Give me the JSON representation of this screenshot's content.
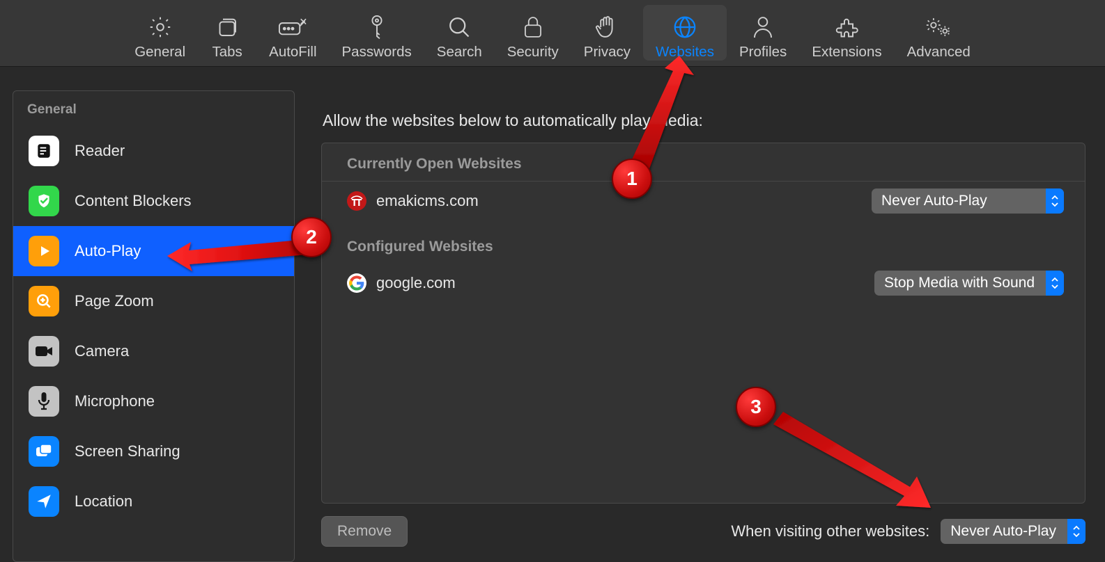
{
  "toolbar": {
    "items": [
      {
        "id": "general",
        "label": "General"
      },
      {
        "id": "tabs",
        "label": "Tabs"
      },
      {
        "id": "autofill",
        "label": "AutoFill"
      },
      {
        "id": "passwords",
        "label": "Passwords"
      },
      {
        "id": "search",
        "label": "Search"
      },
      {
        "id": "security",
        "label": "Security"
      },
      {
        "id": "privacy",
        "label": "Privacy"
      },
      {
        "id": "websites",
        "label": "Websites",
        "active": true
      },
      {
        "id": "profiles",
        "label": "Profiles"
      },
      {
        "id": "extensions",
        "label": "Extensions"
      },
      {
        "id": "advanced",
        "label": "Advanced"
      }
    ]
  },
  "sidebar": {
    "section_label": "General",
    "items": [
      {
        "id": "reader",
        "label": "Reader"
      },
      {
        "id": "contentblockers",
        "label": "Content Blockers"
      },
      {
        "id": "autoplay",
        "label": "Auto-Play",
        "selected": true
      },
      {
        "id": "pagezoom",
        "label": "Page Zoom"
      },
      {
        "id": "camera",
        "label": "Camera"
      },
      {
        "id": "microphone",
        "label": "Microphone"
      },
      {
        "id": "screensharing",
        "label": "Screen Sharing"
      },
      {
        "id": "location",
        "label": "Location"
      }
    ]
  },
  "main": {
    "title": "Allow the websites below to automatically play media:",
    "currently_open_label": "Currently Open Websites",
    "configured_label": "Configured Websites",
    "open_sites": [
      {
        "domain": "emakicms.com",
        "policy": "Never Auto-Play"
      }
    ],
    "configured_sites": [
      {
        "domain": "google.com",
        "policy": "Stop Media with Sound"
      }
    ],
    "remove_label": "Remove",
    "footer_label": "When visiting other websites:",
    "footer_policy": "Never Auto-Play"
  },
  "annotations": {
    "a1": "1",
    "a2": "2",
    "a3": "3"
  }
}
